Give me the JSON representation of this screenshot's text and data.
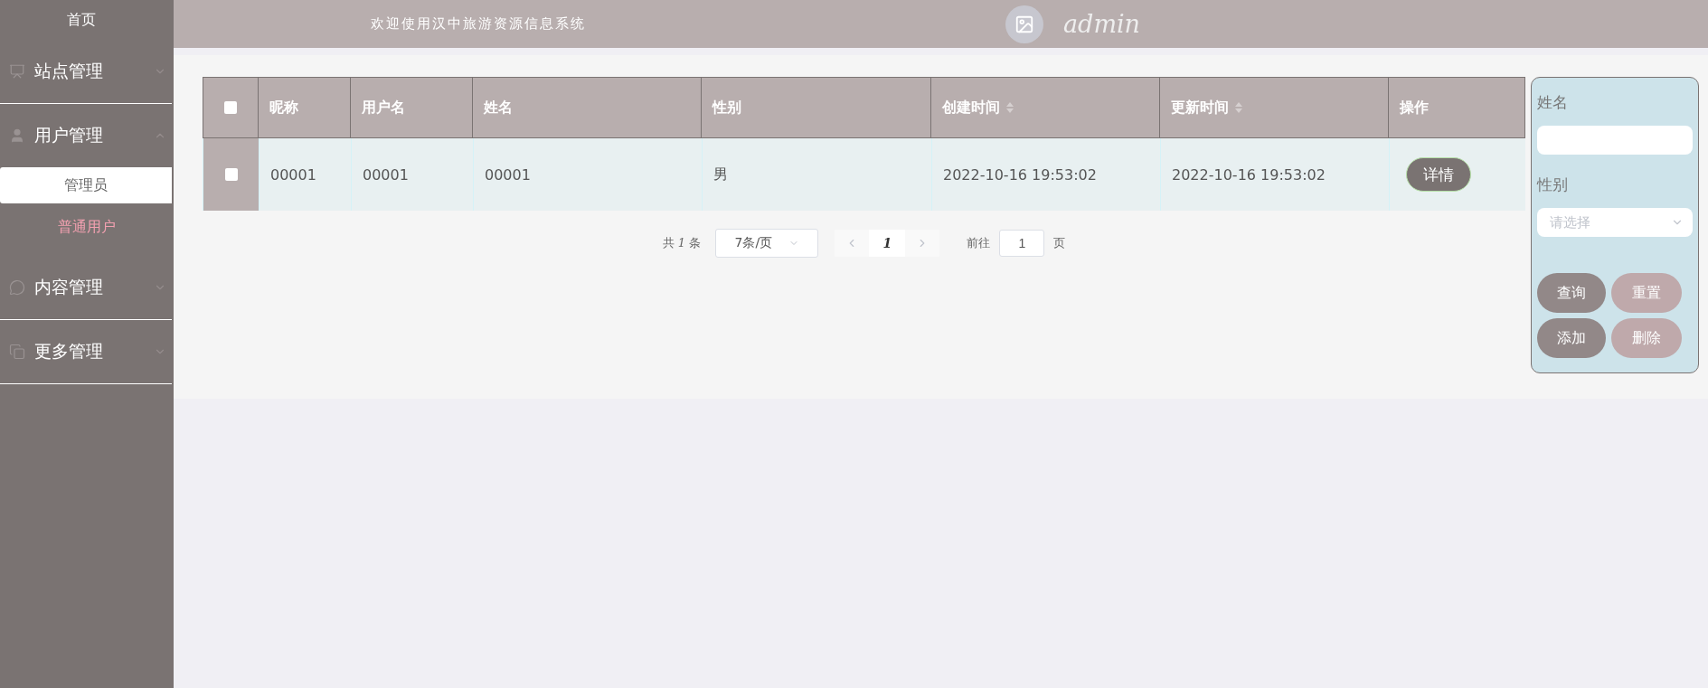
{
  "sidebar": {
    "home": "首页",
    "groups": [
      {
        "label": "站点管理",
        "expanded": false
      },
      {
        "label": "用户管理",
        "expanded": true,
        "children": [
          {
            "label": "管理员",
            "selected": true
          },
          {
            "label": "普通用户",
            "selected": false
          }
        ]
      },
      {
        "label": "内容管理",
        "expanded": false
      },
      {
        "label": "更多管理",
        "expanded": false
      }
    ]
  },
  "header": {
    "title": "欢迎使用汉中旅游资源信息系统",
    "user": "admin"
  },
  "table": {
    "select_all_checked": false,
    "columns": [
      {
        "label": "昵称",
        "sortable": false
      },
      {
        "label": "用户名",
        "sortable": false
      },
      {
        "label": "姓名",
        "sortable": false
      },
      {
        "label": "性别",
        "sortable": false
      },
      {
        "label": "创建时间",
        "sortable": true
      },
      {
        "label": "更新时间",
        "sortable": true
      },
      {
        "label": "操作",
        "sortable": false
      }
    ],
    "rows": [
      {
        "checked": false,
        "cells": [
          "00001",
          "00001",
          "00001",
          "男",
          "2022-10-16 19:53:02",
          "2022-10-16 19:53:02"
        ],
        "action": "详情"
      }
    ]
  },
  "pagination": {
    "total_prefix": "共",
    "total": "1",
    "total_suffix": "条",
    "page_size": "7条/页",
    "page": "1",
    "goto_label": "前往",
    "goto_value": "1",
    "goto_suffix": "页"
  },
  "filter": {
    "fields": [
      {
        "kind": "text",
        "label": "姓名"
      },
      {
        "kind": "select",
        "label": "性别",
        "placeholder": "请选择"
      }
    ],
    "buttons": [
      {
        "label": "查询",
        "kind": "primary"
      },
      {
        "label": "重置",
        "kind": "light"
      },
      {
        "label": "添加",
        "kind": "primary"
      },
      {
        "label": "删除",
        "kind": "light"
      }
    ]
  }
}
